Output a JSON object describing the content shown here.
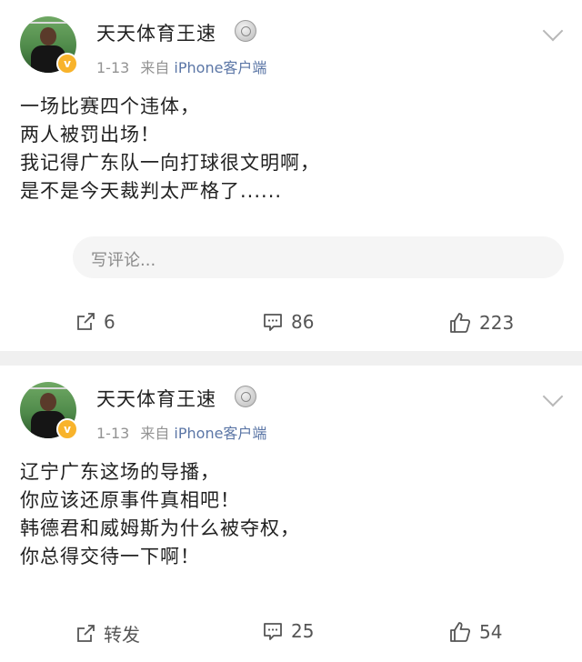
{
  "posts": [
    {
      "author": "天天体育王速",
      "date": "1-13",
      "source_prefix": "来自",
      "device": "iPhone客户端",
      "content_lines": [
        "一场比赛四个违体，",
        "两人被罚出场！",
        "我记得广东队一向打球很文明啊，",
        "是不是今天裁判太严格了......"
      ],
      "comment_placeholder": "写评论...",
      "actions": {
        "share": "6",
        "comment": "86",
        "like": "223"
      }
    },
    {
      "author": "天天体育王速",
      "date": "1-13",
      "source_prefix": "来自",
      "device": "iPhone客户端",
      "content_lines": [
        "辽宁广东这场的导播，",
        "你应该还原事件真相吧！",
        "韩德君和威姆斯为什么被夺权，",
        "你总得交待一下啊！"
      ],
      "actions": {
        "share": "转发",
        "comment": "25",
        "like": "54"
      }
    }
  ],
  "icons": {
    "share": "share-icon",
    "comment": "comment-icon",
    "like": "thumbs-up-icon",
    "verified": "verified-badge-icon",
    "medal": "medal-icon",
    "chevron": "chevron-down-icon"
  },
  "colors": {
    "device_link": "#5b76a6",
    "verified_badge": "#f8b32b",
    "page_bg": "#f0f0f0"
  }
}
